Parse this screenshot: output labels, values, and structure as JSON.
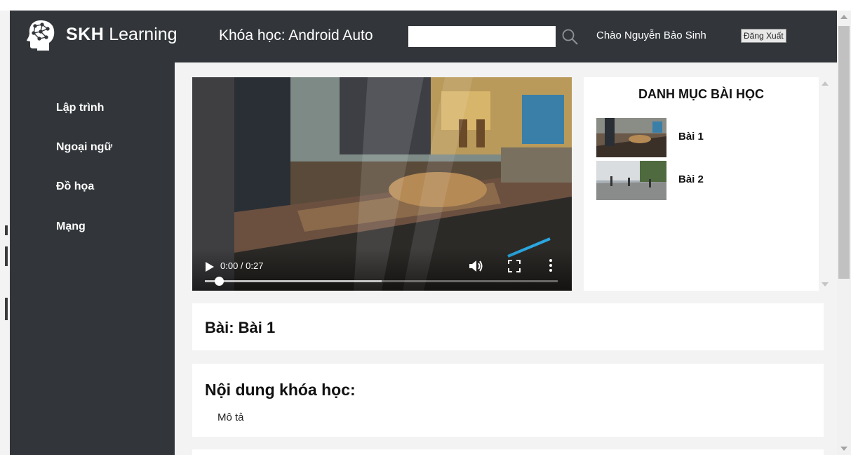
{
  "header": {
    "brand_bold": "SKH",
    "brand_light": "Learning",
    "course_title": "Khóa học: Android Auto",
    "search": {
      "value": "",
      "placeholder": ""
    },
    "greeting": "Chào Nguyễn Bảo Sinh",
    "logout_label": "Đăng Xuất"
  },
  "sidebar": {
    "items": [
      {
        "label": "Lập trình"
      },
      {
        "label": "Ngoại ngữ"
      },
      {
        "label": "Đồ họa"
      },
      {
        "label": "Mạng"
      }
    ]
  },
  "video": {
    "time": "0:00 / 0:27",
    "progress": 0.04,
    "buffered": 0.5
  },
  "lessons": {
    "title": "DANH MỤC BÀI HỌC",
    "items": [
      {
        "label": "Bài 1"
      },
      {
        "label": "Bài 2"
      }
    ]
  },
  "lesson_header": {
    "title": "Bài: Bài 1"
  },
  "course_content": {
    "title": "Nội dung khóa học:",
    "description": "Mô tả"
  },
  "colors": {
    "sidebar_bg": "#32363a",
    "page_bg": "#f3f3f3",
    "panel_bg": "#ffffff",
    "text_light": "#ffffff"
  }
}
